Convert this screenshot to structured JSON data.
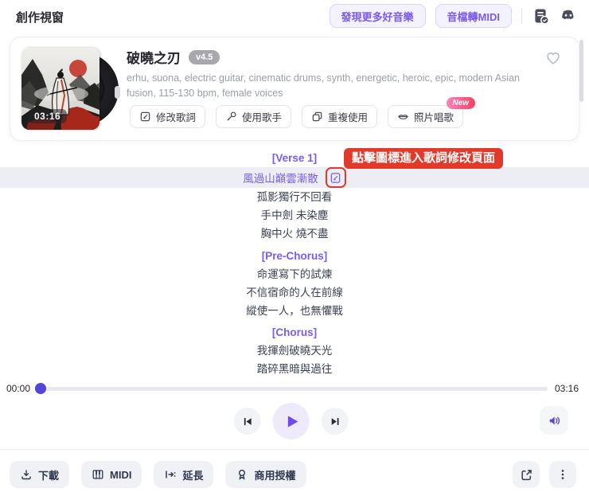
{
  "header": {
    "title": "創作視窗",
    "discover_button": "發現更多好音樂",
    "midi_convert_button": "音檔轉MIDI"
  },
  "song": {
    "title": "破曉之刃",
    "version": "v4.5",
    "duration_badge": "03:16",
    "description": "erhu, suona, electric guitar, cinematic drums, synth, energetic, heroic, epic, modern Asian fusion, 115-130 bpm, female voices",
    "actions": {
      "edit_lyrics": "修改歌詞",
      "use_singer": "使用歌手",
      "reuse": "重複使用",
      "photo_sing": "照片唱歌",
      "new_badge": "New"
    }
  },
  "annotation": "點擊圖標進入歌詞修改頁面",
  "lyrics": {
    "verse1_label": "[Verse 1]",
    "verse1_line1": "風過山巔雲漸散",
    "verse1_line2": "孤影獨行不回看",
    "verse1_line3": "手中劍 未染塵",
    "verse1_line4": "胸中火 燒不盡",
    "prechorus_label": "[Pre-Chorus]",
    "prechorus_line1": "命運寫下的試煉",
    "prechorus_line2": "不信宿命的人在前線",
    "prechorus_line3": "縱使一人，也無懼戰",
    "chorus_label": "[Chorus]",
    "chorus_line1": "我揮劍破曉天光",
    "chorus_line2": "踏碎黑暗與過往"
  },
  "player": {
    "current_time": "00:00",
    "total_time": "03:16",
    "progress_percent": 0
  },
  "footer": {
    "download": "下載",
    "midi": "MIDI",
    "extend": "延長",
    "license": "商用授權"
  },
  "colors": {
    "accent_purple": "#7450F0",
    "annotation_red": "#E2392A",
    "highlight_row_bg": "#EDEEF3"
  }
}
